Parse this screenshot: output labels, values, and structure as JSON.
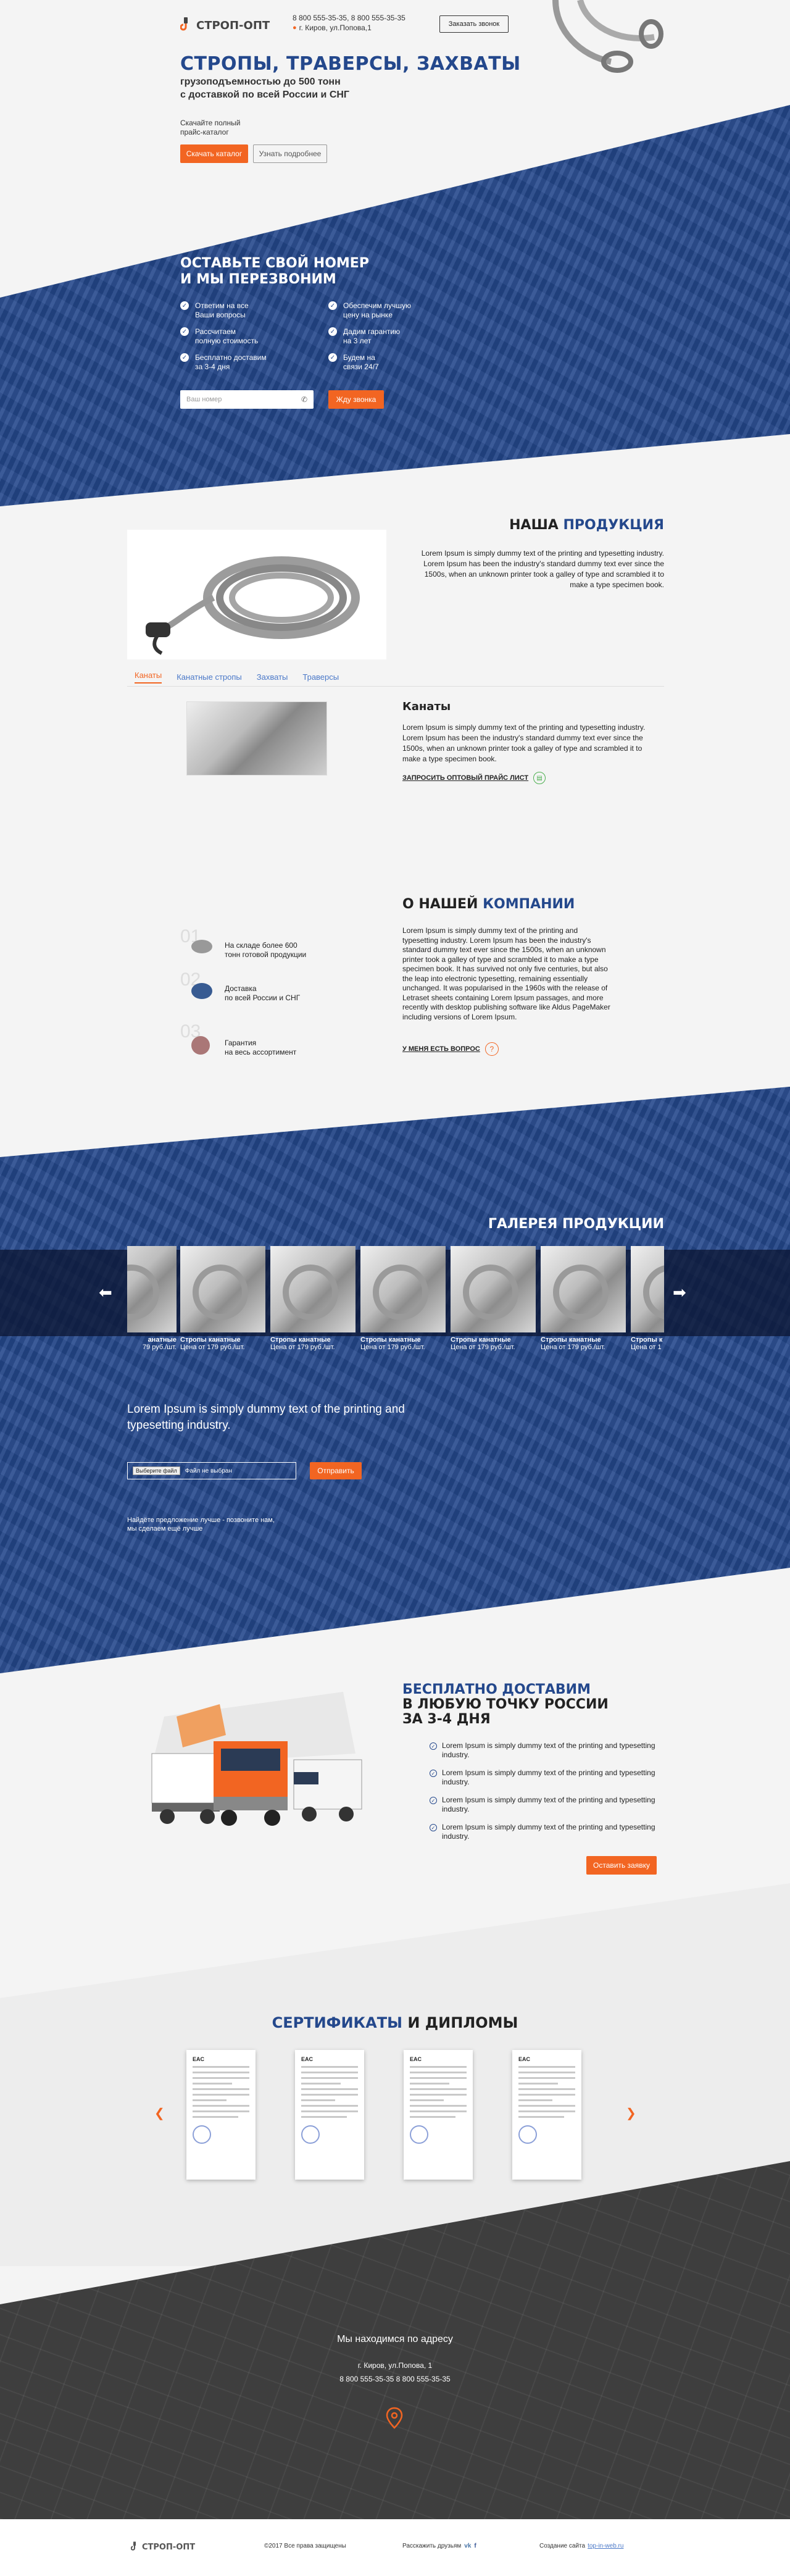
{
  "colors": {
    "primary": "#24488c",
    "accent": "#f26522",
    "text": "#222222"
  },
  "header": {
    "brand": "СТРОП-ОПТ",
    "phones": "8 800 555-35-35, 8 800 555-35-35",
    "address": "г. Киров, ул.Попова,1",
    "call_button": "Заказать звонок"
  },
  "hero": {
    "title": "СТРОПЫ, ТРАВЕРСЫ, ЗАХВАТЫ",
    "subtitle_line1": "грузоподъемностью до 500 тонн",
    "subtitle_line2": "с доставкой по всей России и СНГ",
    "catalog_line1": "Скачайте полный",
    "catalog_line2": "прайс-каталог",
    "download_button": "Скачать каталог",
    "more_button": "Узнать подробнее"
  },
  "callback": {
    "title_line1": "ОСТАВЬТЕ СВОЙ НОМЕР",
    "title_line2": "И МЫ ПЕРЕЗВОНИМ",
    "features": [
      "Ответим на все\nВаши вопросы",
      "Обеспечим лучшую\nцену на рынке",
      "Рассчитаем\nполную стоимость",
      "Дадим гарантию\nна 3 лет",
      "Бесплатно доставим\nза 3-4 дня",
      "Будем на\nсвязи 24/7"
    ],
    "phone_placeholder": "Ваш номер",
    "submit_button": "Жду звонка"
  },
  "products": {
    "title_a": "НАША ",
    "title_b": "ПРОДУКЦИЯ",
    "intro": "Lorem Ipsum is simply dummy text of the printing and typesetting industry. Lorem Ipsum has been the industry's standard dummy text ever since the 1500s, when an unknown printer took a galley of type and scrambled it to make a type specimen book.",
    "tabs": [
      "Канаты",
      "Канатные стропы",
      "Захваты",
      "Траверсы"
    ],
    "item_title": "Канаты",
    "item_text": "Lorem Ipsum is simply dummy text of the printing and typesetting industry. Lorem Ipsum has been the industry's standard dummy text ever since the 1500s, when an unknown printer took a galley of type and scrambled it to make a type specimen book.",
    "price_link": "ЗАПРОСИТЬ ОПТОВЫЙ ПРАЙС ЛИСТ"
  },
  "about": {
    "title_a": "О НАШЕЙ ",
    "title_b": "КОМПАНИИ",
    "items": [
      {
        "num": "01",
        "text": "На складе более 600\nтонн готовой продукции"
      },
      {
        "num": "02",
        "text": "Доставка\nпо всей России и СНГ"
      },
      {
        "num": "03",
        "text": "Гарантия\nна весь ассортимент"
      }
    ],
    "text": "Lorem Ipsum is simply dummy text of the printing and typesetting industry. Lorem Ipsum has been the industry's standard dummy text ever since the 1500s, when an unknown printer took a galley of type and scrambled it to make a type specimen book. It has survived not only five centuries, but also the leap into electronic typesetting, remaining essentially unchanged. It was popularised in the 1960s with the release of Letraset sheets containing Lorem Ipsum passages, and more recently with desktop publishing software like Aldus PageMaker including versions of Lorem Ipsum.",
    "question_link": "У МЕНЯ ЕСТЬ ВОПРОС",
    "question_mark": "?"
  },
  "gallery": {
    "title": "ГАЛЕРЕЯ ПРОДУКЦИИ",
    "items": [
      {
        "name": "анатные",
        "price": "79 руб./шт."
      },
      {
        "name": "Стропы канатные",
        "price": "Цена от 179 руб./шт."
      },
      {
        "name": "Стропы канатные",
        "price": "Цена от 179 руб./шт."
      },
      {
        "name": "Стропы канатные",
        "price": "Цена от 179 руб./шт."
      },
      {
        "name": "Стропы канатные",
        "price": "Цена от 179 руб./шт."
      },
      {
        "name": "Стропы канатные",
        "price": "Цена от 179 руб./шт."
      },
      {
        "name": "Стропы к",
        "price": "Цена от 1"
      }
    ]
  },
  "upload": {
    "title": "Lorem Ipsum is simply dummy text of the printing and typesetting industry.",
    "choose_file": "Выберите файл",
    "no_file": "Файл не выбран",
    "submit": "Отправить",
    "note_line1": "Найдёте предложение лучше - позвоните нам,",
    "note_line2": "мы сделаем ещё лучше"
  },
  "delivery": {
    "title_line1": "БЕСПЛАТНО ДОСТАВИМ",
    "title_line2": "В ЛЮБУЮ ТОЧКУ РОССИИ",
    "title_line3": "ЗА 3-4 ДНЯ",
    "points": [
      "Lorem Ipsum is simply dummy text of the printing and typesetting industry.",
      "Lorem Ipsum is simply dummy text of the printing and typesetting industry.",
      "Lorem Ipsum is simply dummy text of the printing and typesetting industry.",
      "Lorem Ipsum is simply dummy text of the printing and typesetting industry."
    ],
    "order_button": "Оставить заявку"
  },
  "certificates": {
    "title_a": "СЕРТИФИКАТЫ",
    "title_b": " И ДИПЛОМЫ"
  },
  "contacts": {
    "title": "Мы находимся по адресу",
    "address": "г. Киров, ул.Попова, 1",
    "phones": "8 800 555-35-35 8 800 555-35-35"
  },
  "footer": {
    "brand": "СТРОП-ОПТ",
    "copyright": "©2017 Все права защищены",
    "share": "Расскажить друзьям",
    "vk": "vk",
    "fb": "f",
    "made_by": "Создание сайта",
    "made_by_link": "top-in-web.ru"
  }
}
